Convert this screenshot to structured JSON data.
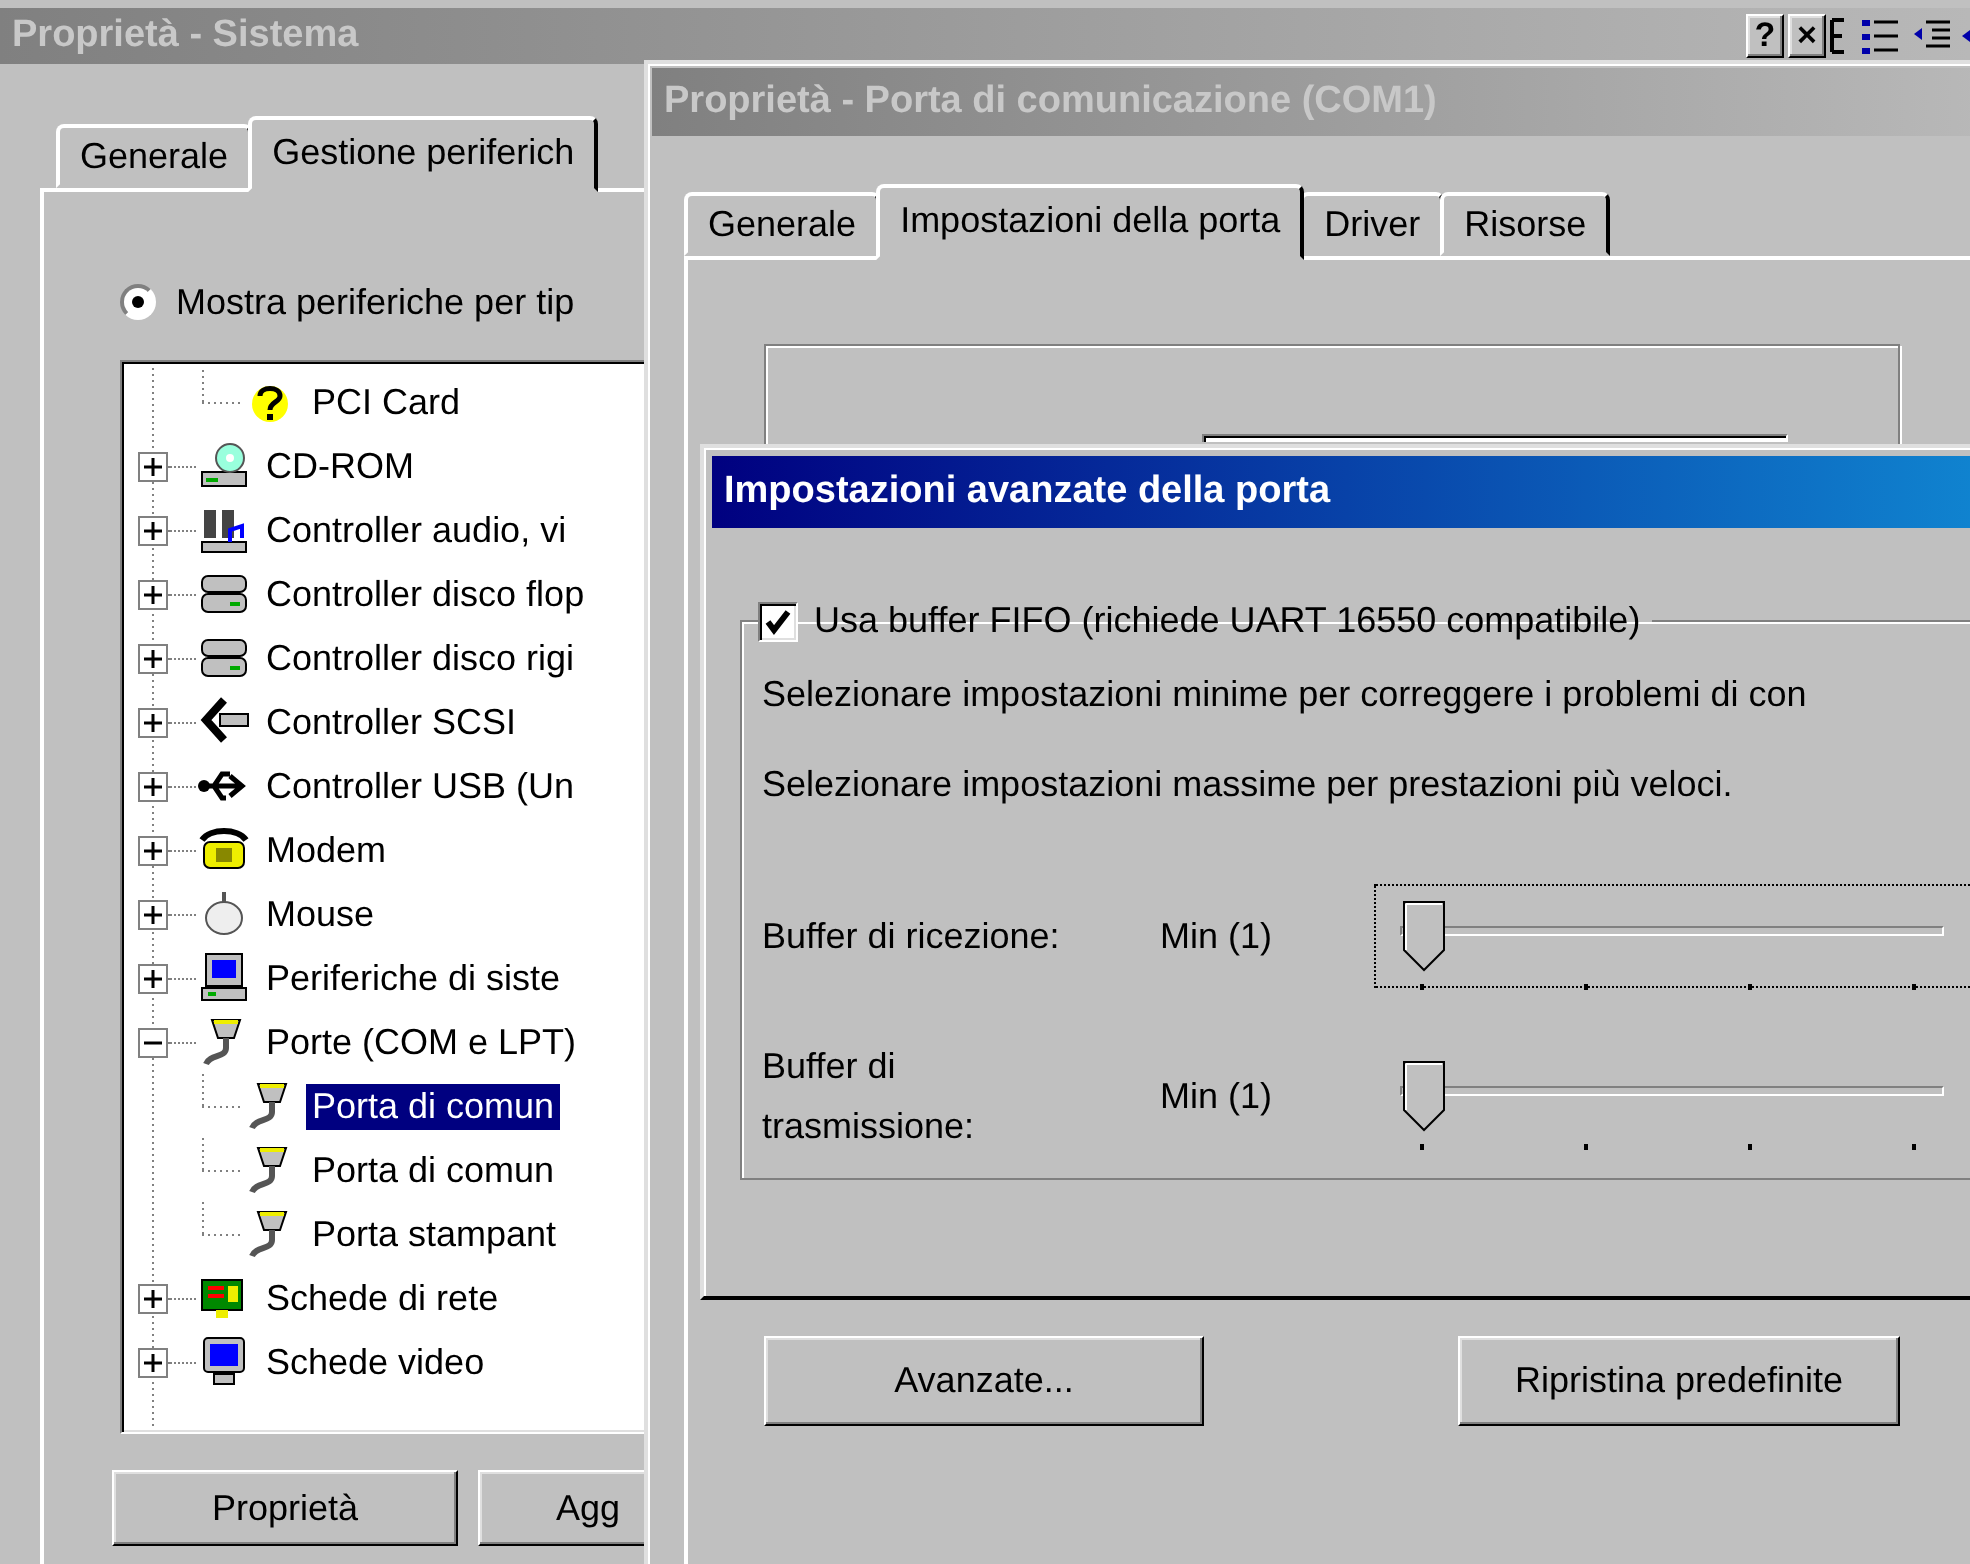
{
  "system_window": {
    "title": "Proprietà - Sistema",
    "active": false,
    "title_buttons": [
      "?",
      "×"
    ],
    "tabs": [
      {
        "label": "Generale",
        "selected": false
      },
      {
        "label": "Gestione periferich",
        "selected": true
      }
    ],
    "view_option": {
      "label": "Mostra periferiche per tip",
      "selected": true
    },
    "tree": {
      "partial_children": [
        {
          "label": "PCI Card",
          "kind": "unknown",
          "selected": false
        }
      ],
      "items": [
        {
          "label": "CD-ROM",
          "kind": "cdrom",
          "expanded": false,
          "selected": false
        },
        {
          "label": "Controller audio, vi",
          "kind": "audio",
          "expanded": false,
          "selected": false
        },
        {
          "label": "Controller disco flop",
          "kind": "drive",
          "expanded": false,
          "selected": false
        },
        {
          "label": "Controller disco rigi",
          "kind": "drive",
          "expanded": false,
          "selected": false
        },
        {
          "label": "Controller SCSI",
          "kind": "scsi",
          "expanded": false,
          "selected": false
        },
        {
          "label": "Controller USB (Un",
          "kind": "usb",
          "expanded": false,
          "selected": false
        },
        {
          "label": "Modem",
          "kind": "modem",
          "expanded": false,
          "selected": false
        },
        {
          "label": "Mouse",
          "kind": "mouse",
          "expanded": false,
          "selected": false
        },
        {
          "label": "Periferiche di siste",
          "kind": "computer",
          "expanded": false,
          "selected": false
        },
        {
          "label": "Porte (COM e LPT)",
          "kind": "port",
          "expanded": true,
          "selected": false,
          "children": [
            {
              "label": "Porta di comun",
              "kind": "port",
              "selected": true
            },
            {
              "label": "Porta di comun",
              "kind": "port",
              "selected": false
            },
            {
              "label": "Porta stampant",
              "kind": "port",
              "selected": false
            }
          ]
        },
        {
          "label": "Schede di rete",
          "kind": "network",
          "expanded": false,
          "selected": false
        },
        {
          "label": "Schede video",
          "kind": "display",
          "expanded": false,
          "selected": false
        }
      ]
    },
    "buttons": [
      {
        "label": "Proprietà"
      },
      {
        "label": "Agg"
      }
    ]
  },
  "com_window": {
    "title": "Proprietà - Porta di comunicazione (COM1)",
    "active": false,
    "tabs": [
      {
        "label": "Generale",
        "selected": false
      },
      {
        "label": "Impostazioni della porta",
        "selected": true
      },
      {
        "label": "Driver",
        "selected": false
      },
      {
        "label": "Risorse",
        "selected": false
      }
    ],
    "buttons": [
      {
        "label": "Avanzate..."
      },
      {
        "label": "Ripristina predefinite"
      }
    ]
  },
  "advanced_dialog": {
    "title": "Impostazioni avanzate della porta",
    "active": true,
    "fifo": {
      "label": "Usa buffer FIFO (richiede UART 16550 compatibile)",
      "checked": true
    },
    "notes": [
      "Selezionare impostazioni minime per correggere i problemi di con",
      "Selezionare impostazioni massime per prestazioni più veloci."
    ],
    "sliders": [
      {
        "label": "Buffer di ricezione:",
        "reading": "Min (1)",
        "level": 0,
        "focused": true
      },
      {
        "label": "Buffer di trasmissione:",
        "reading": "Min (1)",
        "level": 0,
        "focused": false
      }
    ]
  }
}
